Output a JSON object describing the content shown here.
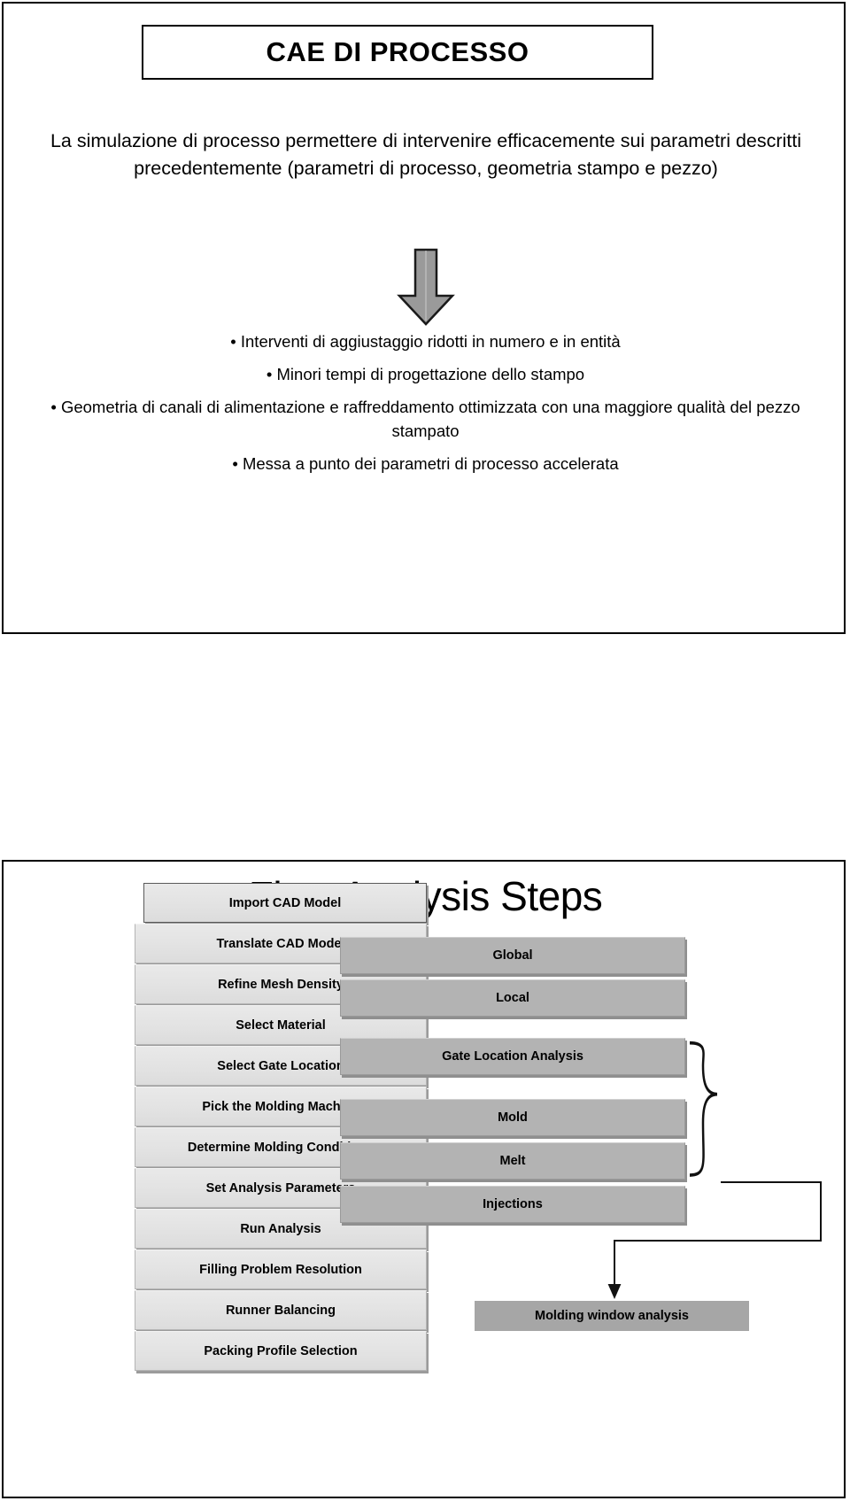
{
  "slide1": {
    "title": "CAE DI PROCESSO",
    "intro": "La simulazione di processo permettere di intervenire efficacemente sui parametri descritti precedentemente (parametri di processo, geometria stampo e pezzo)",
    "arrow_icon": "down-arrow-icon",
    "bullets": [
      "• Interventi di aggiustaggio ridotti in numero e in entità",
      "• Minori tempi di progettazione dello stampo",
      "• Geometria di canali di alimentazione e raffreddamento ottimizzata con una maggiore qualità del pezzo stampato",
      "• Messa a punto dei parametri di processo accelerata"
    ]
  },
  "slide2": {
    "title": "Flow Analysis Steps",
    "main_steps": [
      "Import CAD Model",
      "Translate CAD Model",
      "Refine Mesh Density",
      "Select Material",
      "Select Gate Location",
      "Pick the Molding Machine",
      "Determine Molding Conditions",
      "Set Analysis Parameters",
      "Run Analysis",
      "Filling Problem Resolution",
      "Runner Balancing",
      "Packing Profile Selection"
    ],
    "side_steps": [
      "Global",
      "Local",
      "Gate Location Analysis",
      "Mold",
      "Melt",
      "Injections"
    ],
    "result_step": "Molding window analysis"
  },
  "colors": {
    "light_box": "#e2e2e2",
    "dark_box": "#b3b3b3",
    "flat_dark_box": "#a6a6a6",
    "outline": "#000000",
    "arrow_fill": "#9a9a9a"
  }
}
